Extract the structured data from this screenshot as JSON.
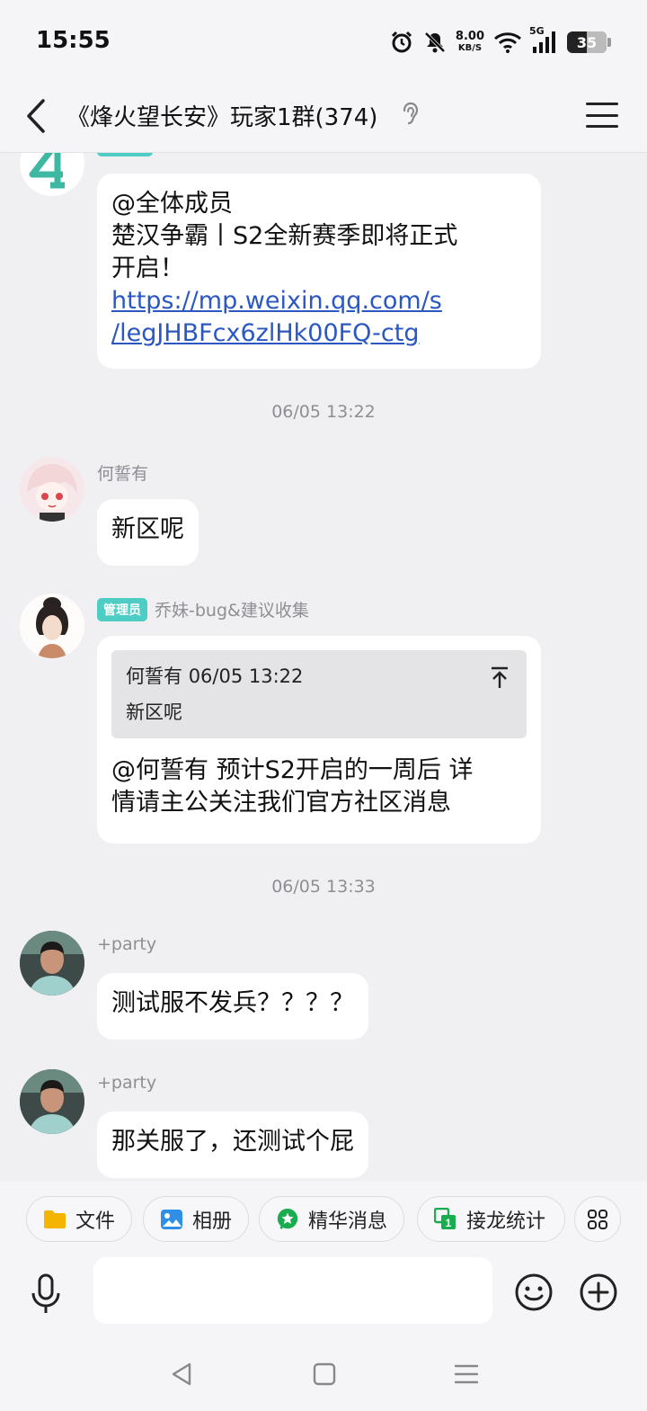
{
  "status_bar": {
    "time": "15:55",
    "net_speed_value": "8.00",
    "net_speed_unit": "KB/S",
    "network": "5G",
    "battery_level": "35"
  },
  "header": {
    "title": "《烽火望长安》玩家1群(374)"
  },
  "messages": {
    "m1": {
      "line1": "@全体成员",
      "line2": "楚汉争霸丨S2全新赛季即将正式",
      "line3": "开启！",
      "link_line1": "https://mp.weixin.qq.com/s",
      "link_line2": "/legJHBFcx6zlHk00FQ-ctg"
    },
    "time_sep_1": "06/05 13:22",
    "m2": {
      "sender": "何誓有",
      "text": "新区呢"
    },
    "m3": {
      "badge": "管理员",
      "sender": "乔妹-bug&建议收集",
      "quote_author": "何誓有",
      "quote_time": "06/05 13:22",
      "quote_text": "新区呢",
      "line1": "@何誓有 预计S2开启的一周后 详",
      "line2": "情请主公关注我们官方社区消息"
    },
    "time_sep_2": "06/05 13:33",
    "m4": {
      "sender": "+party",
      "text": "测试服不发兵？？？？"
    },
    "m5": {
      "sender": "+party",
      "text": "那关服了，还测试个屁"
    }
  },
  "toolbar": {
    "file": "文件",
    "album": "相册",
    "featured": "精华消息",
    "relay": "接龙统计"
  },
  "input": {
    "placeholder": ""
  },
  "colors": {
    "badge": "#4ecdc4",
    "link": "#2a57c2",
    "background": "#f0f0f3"
  }
}
